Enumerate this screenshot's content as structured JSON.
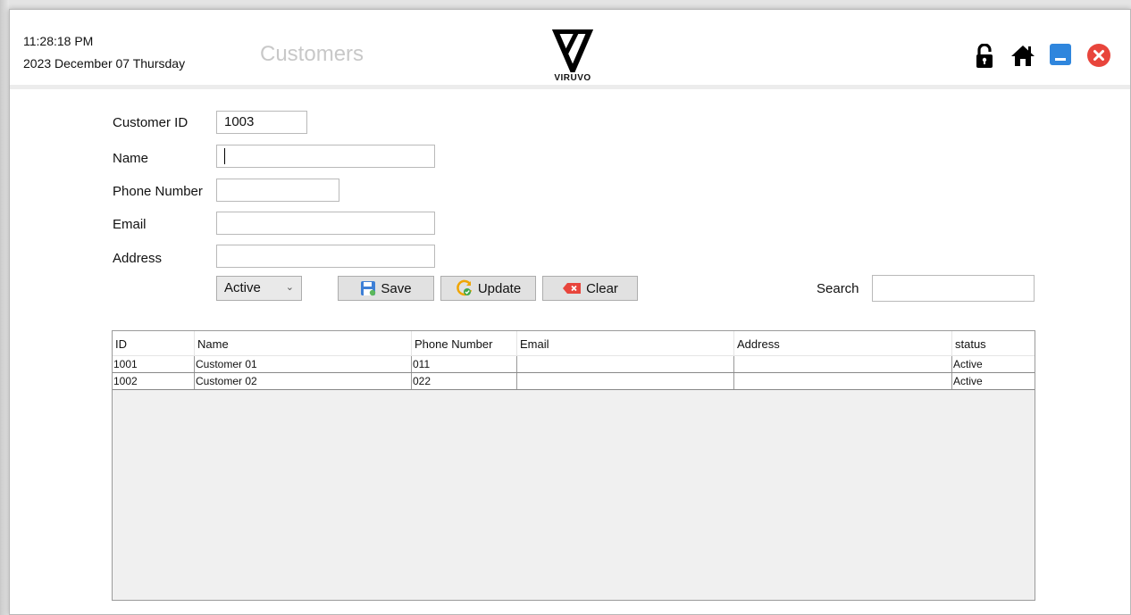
{
  "header": {
    "time": "11:28:18 PM",
    "date": "2023 December 07 Thursday",
    "title": "Customers",
    "logo_text": "VIRUVO",
    "icons": [
      "lock-open-icon",
      "home-icon",
      "minimize-icon",
      "close-icon"
    ]
  },
  "form": {
    "customer_id_label": "Customer ID",
    "customer_id_value": "1003",
    "name_label": "Name",
    "name_value": "",
    "phone_label": "Phone Number",
    "phone_value": "",
    "email_label": "Email",
    "email_value": "",
    "address_label": "Address",
    "address_value": "",
    "status_select": "Active"
  },
  "actions": {
    "save_label": "Save",
    "update_label": "Update",
    "clear_label": "Clear"
  },
  "search": {
    "label": "Search",
    "value": ""
  },
  "table": {
    "columns": [
      "ID",
      "Name",
      "Phone Number",
      "Email",
      "Address",
      "status"
    ],
    "rows": [
      [
        "1001",
        "Customer 01",
        "011",
        "",
        "",
        "Active"
      ],
      [
        "1002",
        "Customer 02",
        "022",
        "",
        "",
        "Active"
      ]
    ]
  },
  "colors": {
    "minimize": "#2f86dd",
    "close": "#e8453c",
    "clear_icon": "#e8453c",
    "update_icon": "#f0a500"
  }
}
